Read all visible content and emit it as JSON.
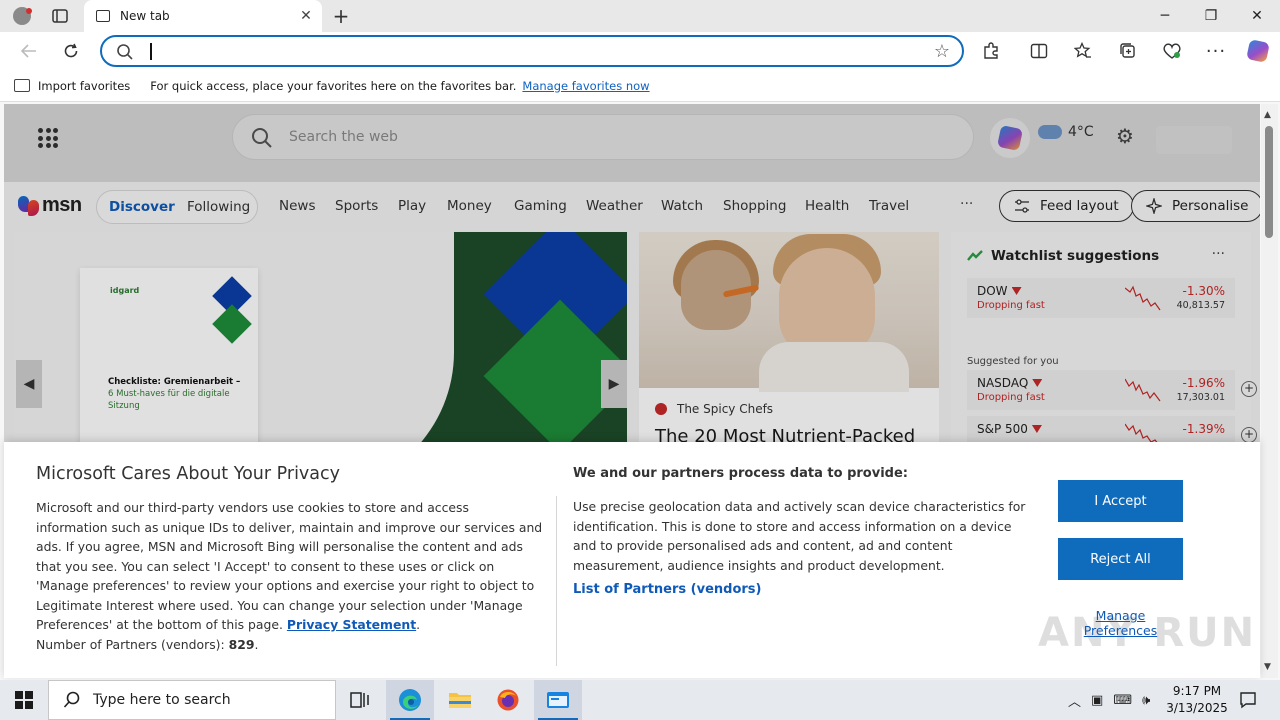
{
  "browser": {
    "tab_title": "New tab",
    "tab_close": "✕",
    "new_tab": "+",
    "window_controls": {
      "minimize": "─",
      "restore": "❐",
      "close": "✕"
    },
    "address_value": "",
    "favorites_bar": {
      "import_label": "Import favorites",
      "message": "For quick access, place your favorites here on the favorites bar.",
      "manage_link": "Manage favorites now"
    }
  },
  "msn": {
    "search_placeholder": "Search the web",
    "weather_temp": "4°C",
    "logo_text": "msn",
    "tabs": {
      "discover": "Discover",
      "following": "Following"
    },
    "nav_items": [
      "News",
      "Sports",
      "Play",
      "Money",
      "Gaming",
      "Weather",
      "Watch",
      "Shopping",
      "Health",
      "Travel"
    ],
    "more": "···",
    "feed_layout": "Feed layout",
    "personalise": "Personalise",
    "main_card": {
      "brand": "idgard",
      "heading": "Checkliste: Gremienarbeit –",
      "subheading": "6 Must-haves für die digitale Sitzung",
      "colors": {
        "navy": "#0b3fa8",
        "green": "#1e8c3a",
        "dark_green": "#1e4d2b"
      }
    },
    "story_card": {
      "source": "The Spicy Chefs",
      "headline": "The 20 Most Nutrient-Packed"
    },
    "watchlist": {
      "title": "Watchlist suggestions",
      "suggested_label": "Suggested for you",
      "stocks": [
        {
          "symbol": "DOW",
          "status": "Dropping fast",
          "change": "-1.30%",
          "value": "40,813.57"
        },
        {
          "symbol": "NASDAQ",
          "status": "Dropping fast",
          "change": "-1.96%",
          "value": "17,303.01"
        },
        {
          "symbol": "S&P 500",
          "status": "",
          "change": "-1.39%",
          "value": ""
        }
      ]
    }
  },
  "privacy": {
    "title": "Microsoft Cares About Your Privacy",
    "body": "Microsoft and our third-party vendors use cookies to store and access information such as unique IDs to deliver, maintain and improve our services and ads. If you agree, MSN and Microsoft Bing will personalise the content and ads that you see. You can select 'I Accept' to consent to these uses or click on 'Manage preferences' to review your options and exercise your right to object to Legitimate Interest where used.  You can change your selection under 'Manage Preferences' at the bottom of this page.",
    "privacy_link": "Privacy Statement",
    "partners_count_label": "Number of Partners (vendors):",
    "partners_count": "829",
    "sub_title": "We and our partners process data to provide:",
    "body2": "Use precise geolocation data and actively scan device characteristics for identification. This is done to store and access information on a device and to provide personalised ads and content, ad and content measurement, audience insights and product development.",
    "partners_link": "List of Partners (vendors)",
    "accept": "I Accept",
    "reject": "Reject All",
    "manage": "Manage Preferences",
    "watermark": "ANY RUN"
  },
  "taskbar": {
    "search_placeholder": "Type here to search",
    "time": "9:17 PM",
    "date": "3/13/2025"
  },
  "colors": {
    "accent": "#0f6cbd",
    "link": "#0f5ab8",
    "negative": "#c62828"
  }
}
